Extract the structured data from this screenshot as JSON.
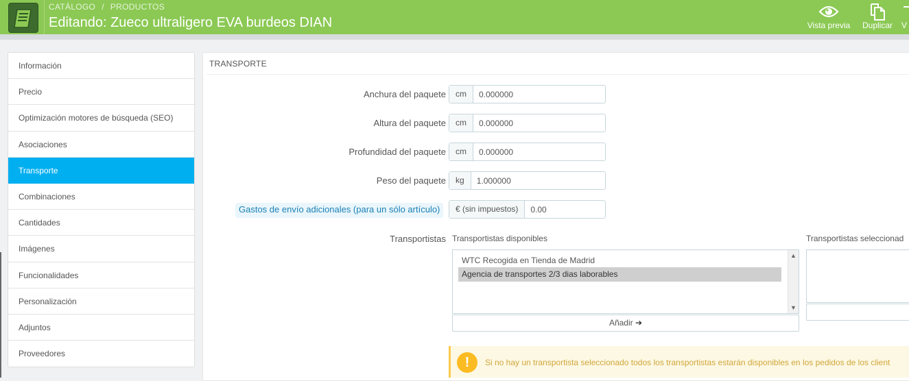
{
  "header": {
    "breadcrumb": [
      "CATÁLOGO",
      "PRODUCTOS"
    ],
    "breadcrumb_sep": "/",
    "title": "Editando: Zueco ultraligero EVA burdeos DIAN",
    "toolbar": [
      {
        "label": "Vista previa",
        "icon": "eye-icon"
      },
      {
        "label": "Duplicar",
        "icon": "copy-icon"
      },
      {
        "label": "V",
        "icon": "truncated-icon"
      }
    ],
    "colors": {
      "bar": "#8bc954",
      "logo": "#3d6b2d"
    }
  },
  "tabs": [
    {
      "label": "Información"
    },
    {
      "label": "Precio"
    },
    {
      "label": "Optimización motores de búsqueda (SEO)"
    },
    {
      "label": "Asociaciones"
    },
    {
      "label": "Transporte",
      "active": true
    },
    {
      "label": "Combinaciones"
    },
    {
      "label": "Cantidades"
    },
    {
      "label": "Imágenes"
    },
    {
      "label": "Funcionalidades"
    },
    {
      "label": "Personalización"
    },
    {
      "label": "Adjuntos"
    },
    {
      "label": "Proveedores"
    }
  ],
  "panel": {
    "heading": "TRANSPORTE",
    "fields": {
      "width": {
        "label": "Anchura del paquete",
        "unit": "cm",
        "value": "0.000000"
      },
      "height": {
        "label": "Altura del paquete",
        "unit": "cm",
        "value": "0.000000"
      },
      "depth": {
        "label": "Profundidad del paquete",
        "unit": "cm",
        "value": "0.000000"
      },
      "weight": {
        "label": "Peso del paquete",
        "unit": "kg",
        "value": "1.000000"
      },
      "shipping": {
        "label": "Gastos de envío adicionales (para un sólo artículo)",
        "unit": "€ (sin impuestos)",
        "value": "0.00"
      }
    },
    "carriers": {
      "label": "Transportistas",
      "available_title": "Transportistas disponibles",
      "selected_title": "Transportistas seleccionad",
      "available": [
        {
          "label": "WTC Recogida en Tienda de Madrid",
          "selected": false
        },
        {
          "label": "Agencia de transportes 2/3 dias laborables",
          "selected": true
        }
      ],
      "add_label": "Añadir"
    },
    "warning": "Si no hay un transportista seleccionado todos los transportistas estarán disponibles en los pedidos de los client",
    "colors": {
      "active_tab": "#00aff0",
      "warning_bg": "#fcf8e3",
      "warning_icon": "#fbbb22"
    }
  }
}
